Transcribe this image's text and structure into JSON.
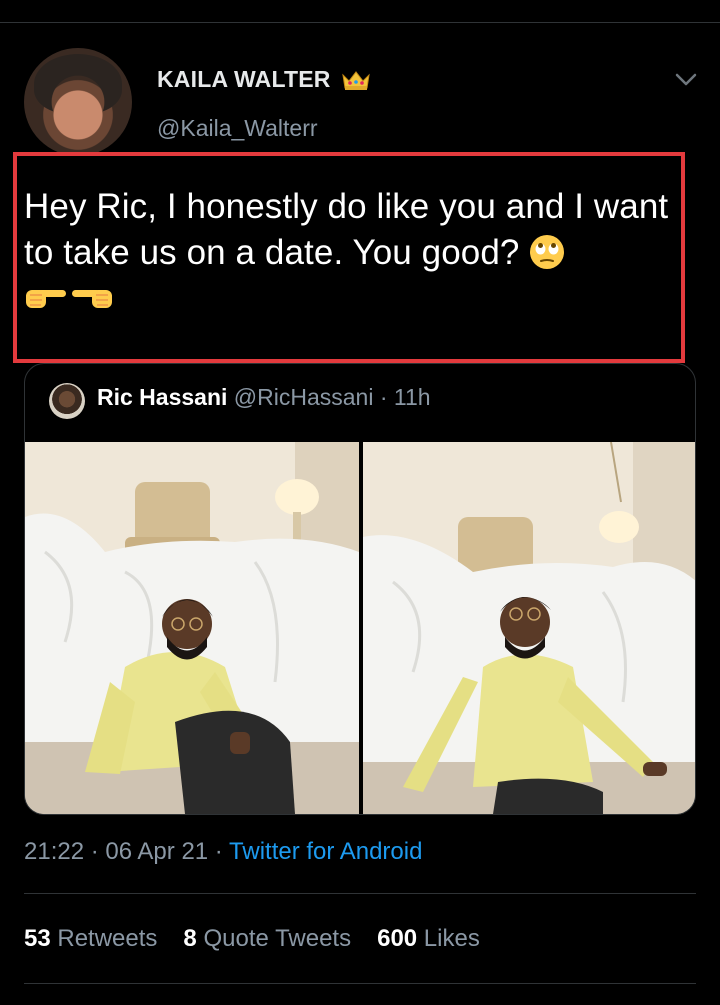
{
  "tweet": {
    "author_name": "KAILA WALTER",
    "author_handle": "@Kaila_Walterr",
    "text": "Hey Ric, I honestly do like you and I want to take us on a date. You good?",
    "timestamp": "21:22 · 06 Apr 21 · ",
    "source": "Twitter for Android",
    "icons": [
      "crown-icon",
      "chevron-down-icon",
      "eye-roll-emoji",
      "pointing-right-emoji",
      "pointing-left-emoji"
    ]
  },
  "quoted_tweet": {
    "name": "Ric Hassani",
    "handle_and_time": " @RicHassani · 11h"
  },
  "stats": {
    "retweets_count": "53",
    "retweets_label": " Retweets",
    "quotes_count": "8",
    "quotes_label": " Quote Tweets",
    "likes_count": "600",
    "likes_label": " Likes"
  },
  "colors": {
    "background": "#000000",
    "secondary_text": "#8b98a5",
    "link": "#1d9bf0",
    "highlight_border": "#e33a3d",
    "divider": "#2f3336"
  }
}
